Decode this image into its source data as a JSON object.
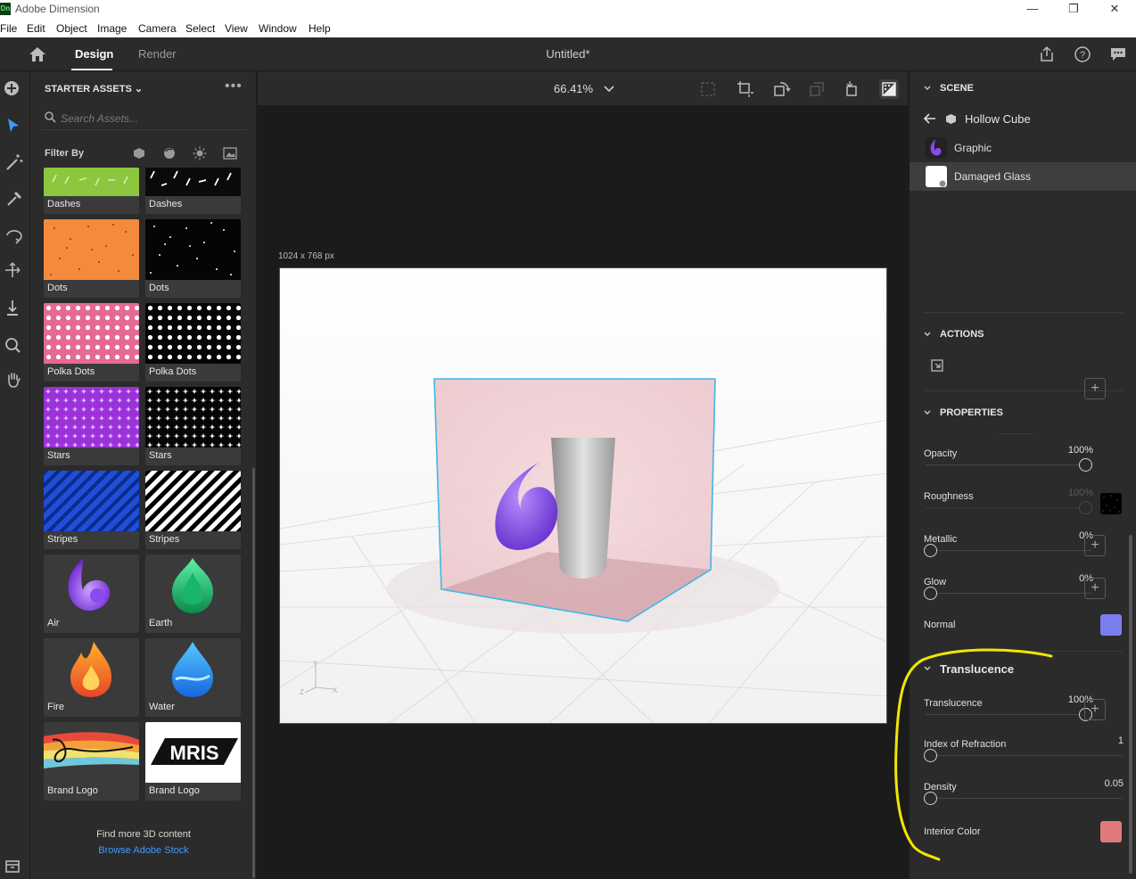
{
  "window": {
    "app_icon": "Dn",
    "title": "Adobe Dimension",
    "controls": [
      "—",
      "❐",
      "✕"
    ]
  },
  "menu": [
    "File",
    "Edit",
    "Object",
    "Image",
    "Camera",
    "Select",
    "View",
    "Window",
    "Help"
  ],
  "top": {
    "tabs": [
      "Design",
      "Render"
    ],
    "doc_title": "Untitled*"
  },
  "assets": {
    "header": "STARTER ASSETS",
    "search_placeholder": "Search Assets...",
    "filter_label": "Filter By",
    "items": [
      {
        "label": "Dashes",
        "thumb": "dashes-green"
      },
      {
        "label": "Dashes",
        "thumb": "dashes-black"
      },
      {
        "label": "Dots",
        "thumb": "dots-orange"
      },
      {
        "label": "Dots",
        "thumb": "dots-black"
      },
      {
        "label": "Polka Dots",
        "thumb": "polka-pink"
      },
      {
        "label": "Polka Dots",
        "thumb": "polka-black"
      },
      {
        "label": "Stars",
        "thumb": "stars-purple"
      },
      {
        "label": "Stars",
        "thumb": "stars-black"
      },
      {
        "label": "Stripes",
        "thumb": "stripes-blue"
      },
      {
        "label": "Stripes",
        "thumb": "stripes-bw"
      },
      {
        "label": "Air",
        "thumb": "air"
      },
      {
        "label": "Earth",
        "thumb": "earth"
      },
      {
        "label": "Fire",
        "thumb": "fire"
      },
      {
        "label": "Water",
        "thumb": "water"
      },
      {
        "label": "Brand Logo",
        "thumb": "brand-paint"
      },
      {
        "label": "Brand Logo",
        "thumb": "brand-mris"
      }
    ],
    "find_more": "Find more 3D content",
    "browse_link": "Browse Adobe Stock",
    "brand_text": "MRIS"
  },
  "viewport": {
    "zoom": "66.41%",
    "canvas_size": "1024 x 768 px",
    "axis": {
      "y": "Y",
      "z": "Z",
      "x": "X"
    }
  },
  "scene": {
    "header": "SCENE",
    "object": "Hollow Cube",
    "items": [
      {
        "name": "Graphic",
        "selected": false
      },
      {
        "name": "Damaged Glass",
        "selected": true
      }
    ]
  },
  "actions": {
    "header": "ACTIONS"
  },
  "properties": {
    "header": "PROPERTIES",
    "opacity": {
      "label": "Opacity",
      "value": "100%",
      "level": 1.0
    },
    "roughness": {
      "label": "Roughness",
      "value": "100%",
      "level": 1.0
    },
    "metallic": {
      "label": "Metallic",
      "value": "0%",
      "level": 0.0
    },
    "glow": {
      "label": "Glow",
      "value": "0%",
      "level": 0.0
    },
    "normal": {
      "label": "Normal",
      "color": "#7b7ef0"
    }
  },
  "translucence": {
    "header": "Translucence",
    "translucence": {
      "label": "Translucence",
      "value": "100%",
      "level": 1.0
    },
    "ior": {
      "label": "Index of Refraction",
      "value": "1",
      "level": 0.0
    },
    "density": {
      "label": "Density",
      "value": "0.05",
      "level": 0.0
    },
    "interior_color": {
      "label": "Interior Color",
      "color": "#e07a7a"
    }
  },
  "colors": {
    "accent": "#3d9bff",
    "selection": "#41b6e6",
    "annotation": "#f2e600"
  }
}
